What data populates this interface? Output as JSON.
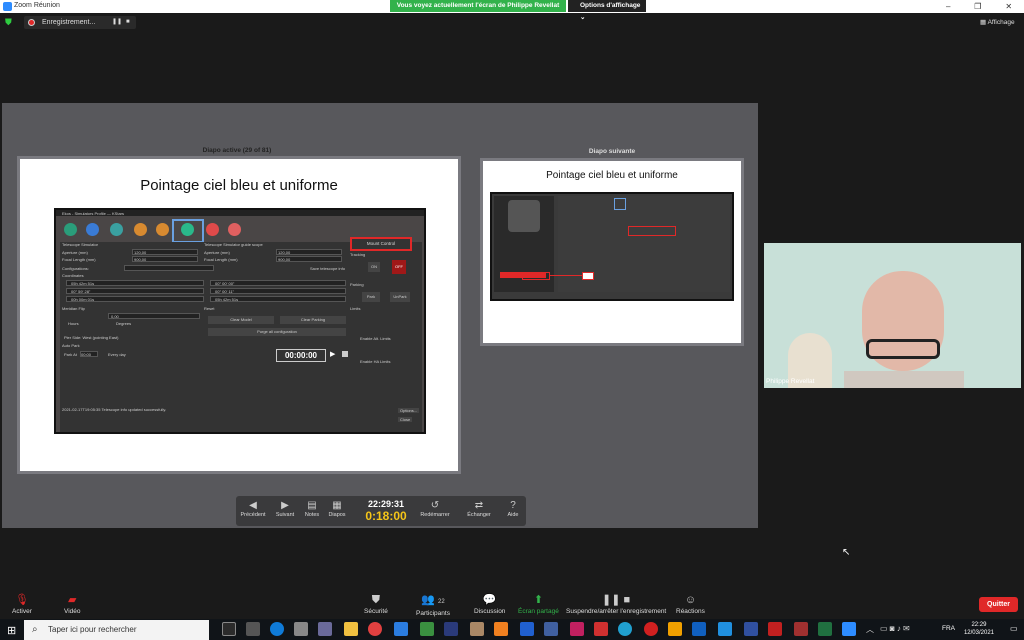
{
  "window": {
    "title": "Zoom Réunion",
    "controls": [
      "–",
      "❐",
      "✕"
    ]
  },
  "share": {
    "banner": "Vous voyez actuellement l'écran de Philippe Revellat",
    "view_options": "Options d'affichage ⌄"
  },
  "recording": {
    "label": "Enregistrement...",
    "pause": "❚❚",
    "stop": "■"
  },
  "affichage": "Affichage",
  "presenter": {
    "current_caption": "Diapo active (29 of 81)",
    "next_caption": "Diapo suivante",
    "slide_title": "Pointage ciel bleu et uniforme",
    "next_slide_title": "Pointage ciel bleu et uniforme",
    "screenshot": {
      "title": "Ekos - Simulators Profile — KStars",
      "tele_sim": "Telescope Simulator",
      "guide_scope": "Telescope Simulator guide scope",
      "aperture": "Aperture (mm)",
      "focal": "Focal Length (mm)",
      "aperture_val": "120,00",
      "focal_val": "900,00",
      "mount_control": "Mount Control",
      "configurations": "Configurations:",
      "save_info": "Save telescope info",
      "tracking": "Tracking",
      "on": "ON",
      "off": "OFF",
      "coords": "Coordinates",
      "ra": "05h 42m 51s",
      "de": "00° 00' 00\"",
      "az": "00° 59' 28\"",
      "alt": "00° 00' 11\"",
      "ha": "00h 00m 01s",
      "lst": "05h 42m 51s",
      "parking": "Parking",
      "park": "Park",
      "unpark": "UnPark",
      "meridian": "Meridian Flip",
      "flip_val": "0,00",
      "hours": "Hours",
      "degrees": "Degrees",
      "pier": "Pier Side: West (pointing East)",
      "autopark": "Auto Park",
      "park_at": "Park At",
      "park_time": "00:00",
      "every_day": "Every day",
      "reset": "Reset",
      "clear_model": "Clear Model",
      "clear_parking": "Clear Parking",
      "purge": "Purge all configuration",
      "limits": "Limits",
      "alt_limits": "Enable Alt. Limits",
      "ha_limits": "Enable HA Limits",
      "timer": "00:00:00",
      "log": "2021-02-17T19:05:35 Telescope info updated successfully.",
      "options": "Options...",
      "close": "Close"
    },
    "buttons": [
      {
        "label": "Précédent",
        "icon": "◀"
      },
      {
        "label": "Suivant",
        "icon": "▶"
      },
      {
        "label": "Notes",
        "icon": "▤"
      },
      {
        "label": "Diapos",
        "icon": "▦"
      },
      {
        "label": "Redémarrer",
        "icon": "↺"
      },
      {
        "label": "Échanger",
        "icon": "⇄"
      },
      {
        "label": "Aide",
        "icon": "?"
      }
    ],
    "clock": "22:29:31",
    "elapsed": "0:18:00"
  },
  "camera": {
    "name": "Philippe Revellat"
  },
  "toolbar": {
    "mute": "Activer",
    "video": "Vidéo",
    "security": "Sécurité",
    "participants": "Participants",
    "participants_count": "22",
    "chat": "Discussion",
    "share_screen": "Écran partagé",
    "pause_share": "Suspendre/arrêter l'enregistrement",
    "reactions": "Réactions",
    "leave": "Quitter"
  },
  "taskbar": {
    "search_placeholder": "Taper ici pour rechercher",
    "lang": "FRA",
    "time": "22:29",
    "date": "12/03/2021"
  }
}
